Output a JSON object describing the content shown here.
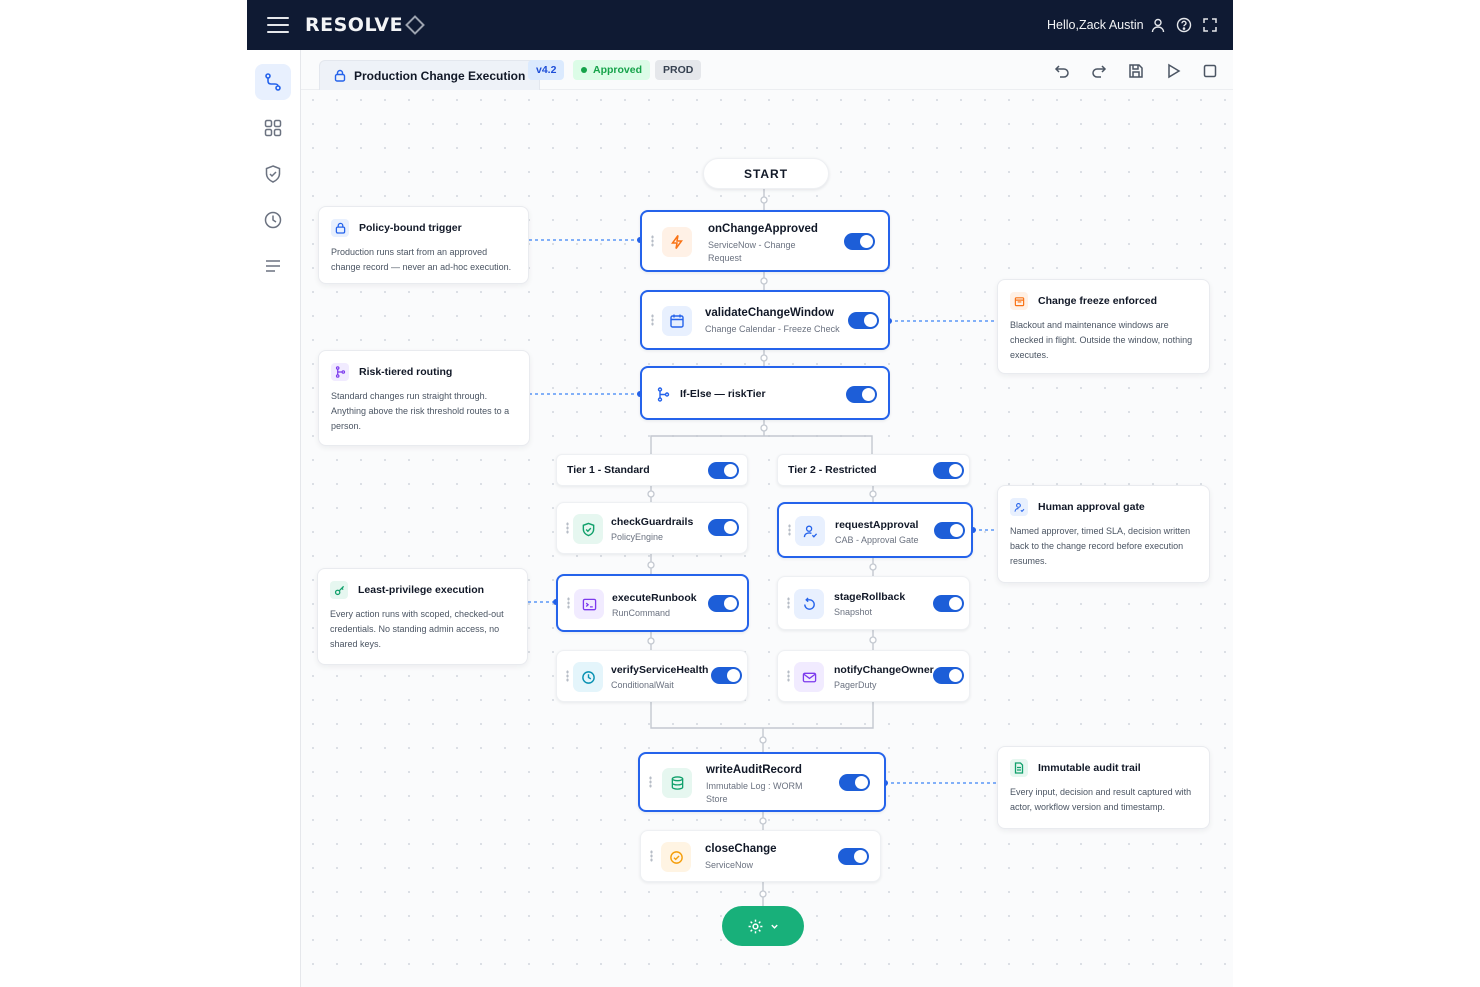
{
  "header": {
    "brand": "RESOLVE",
    "greeting": "Hello,Zack Austin"
  },
  "tab": {
    "title": "Production Change Execution"
  },
  "badges": {
    "version": "v4.2",
    "status": "Approved",
    "env": "PROD"
  },
  "colors": {
    "topbar": "#0f1a33",
    "accent": "#2563eb",
    "toggle": "#1d5ed8",
    "success": "#18b07a",
    "approved_bg": "#dcfce7",
    "approved_text": "#16a34a"
  },
  "flow": {
    "start": "START",
    "nodes": {
      "onChangeApproved": {
        "title": "onChangeApproved",
        "subtitle": "ServiceNow - Change Request",
        "icon": "lightning-icon"
      },
      "validateChangeWindow": {
        "title": "validateChangeWindow",
        "subtitle": "Change Calendar - Freeze Check",
        "icon": "calendar-icon"
      },
      "ifElse": {
        "title": "If-Else — riskTier",
        "icon": "branch-icon"
      },
      "checkGuardrails": {
        "title": "checkGuardrails",
        "subtitle": "PolicyEngine",
        "icon": "shield-check-icon"
      },
      "requestApproval": {
        "title": "requestApproval",
        "subtitle": "CAB - Approval Gate",
        "icon": "user-check-icon"
      },
      "executeRunbook": {
        "title": "executeRunbook",
        "subtitle": "RunCommand",
        "icon": "terminal-icon"
      },
      "stageRollback": {
        "title": "stageRollback",
        "subtitle": "Snapshot",
        "icon": "rollback-icon"
      },
      "verifyServiceHealth": {
        "title": "verifyServiceHealth",
        "subtitle": "ConditionalWait",
        "icon": "clock-icon"
      },
      "notifyChangeOwner": {
        "title": "notifyChangeOwner",
        "subtitle": "PagerDuty",
        "icon": "mail-icon"
      },
      "writeAuditRecord": {
        "title": "writeAuditRecord",
        "subtitle": "Immutable Log : WORM Store",
        "icon": "database-icon"
      },
      "closeChange": {
        "title": "closeChange",
        "subtitle": "ServiceNow",
        "icon": "check-circle-icon"
      }
    },
    "branches": {
      "tier1": "Tier 1 - Standard",
      "tier2": "Tier 2 - Restricted"
    }
  },
  "notes": {
    "policy": {
      "title": "Policy-bound trigger",
      "body": "Production runs start from an approved change record — never an ad-hoc execution."
    },
    "freeze": {
      "title": "Change freeze enforced",
      "body": "Blackout and maintenance windows are checked in flight. Outside the window, nothing executes."
    },
    "risk": {
      "title": "Risk-tiered routing",
      "body": "Standard changes run straight through. Anything above the risk threshold routes to a person."
    },
    "approval": {
      "title": "Human approval gate",
      "body": "Named approver, timed SLA, decision written back to the change record before execution resumes."
    },
    "privilege": {
      "title": "Least-privilege execution",
      "body": "Every action runs with scoped, checked-out credentials. No standing admin access, no shared keys."
    },
    "audit": {
      "title": "Immutable audit trail",
      "body": "Every input, decision and result captured with actor, workflow version and timestamp."
    }
  }
}
